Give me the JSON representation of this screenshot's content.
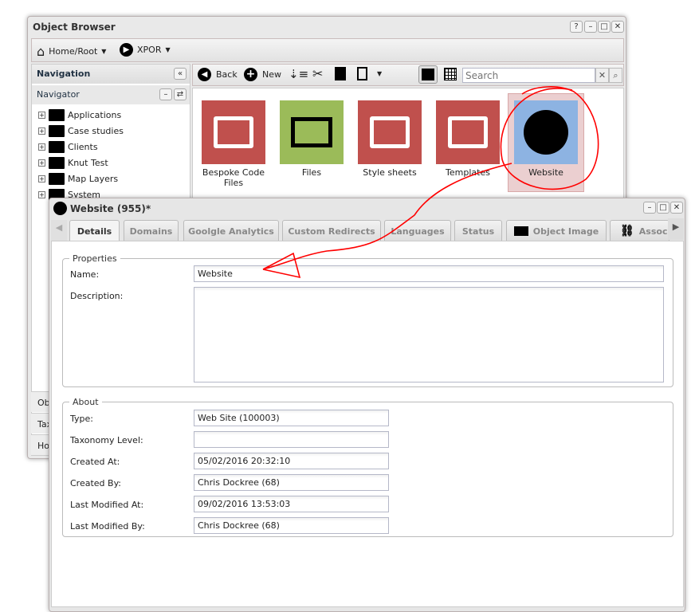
{
  "browser": {
    "title": "Object Browser",
    "title_buttons": [
      "?",
      "–",
      "□",
      "✕"
    ],
    "breadcrumb": [
      {
        "label": "Home/Root",
        "icon": "home-icon"
      },
      {
        "label": "XPOR",
        "icon": "arrow-right-circle-icon"
      }
    ],
    "navigation": {
      "title": "Navigation",
      "navigator_title": "Navigator",
      "tree": [
        "Applications",
        "Case studies",
        "Clients",
        "Knut Test",
        "Map Layers",
        "System"
      ]
    },
    "accordion": [
      "Obj",
      "Tax",
      "Hot"
    ],
    "toolbar": {
      "back": "Back",
      "new": "New",
      "search_placeholder": "Search"
    },
    "tiles": [
      {
        "label": "Bespoke Code Files",
        "color": "#c0504d",
        "icon": "folder-icon"
      },
      {
        "label": "Files",
        "color": "#9bbb59",
        "icon": "images-icon"
      },
      {
        "label": "Style sheets",
        "color": "#c0504d",
        "icon": "folder-icon"
      },
      {
        "label": "Templates",
        "color": "#c0504d",
        "icon": "folder-icon"
      },
      {
        "label": "Website",
        "color": "#8db3e2",
        "icon": "globe-wrench-icon",
        "selected": true
      }
    ]
  },
  "editor": {
    "title": "Website (955)*",
    "tabs": [
      "Details",
      "Domains",
      "Goolgle Analytics",
      "Custom Redirects",
      "Languages",
      "Status",
      "Object Image",
      "Associ"
    ],
    "active_tab": "Details",
    "properties": {
      "legend": "Properties",
      "name_label": "Name:",
      "name_value": "Website",
      "description_label": "Description:",
      "description_value": ""
    },
    "about": {
      "legend": "About",
      "rows": [
        {
          "label": "Type:",
          "value": "Web Site (100003)"
        },
        {
          "label": "Taxonomy Level:",
          "value": ""
        },
        {
          "label": "Created At:",
          "value": "05/02/2016 20:32:10"
        },
        {
          "label": "Created By:",
          "value": "Chris Dockree (68)"
        },
        {
          "label": "Last Modified At:",
          "value": "09/02/2016 13:53:03"
        },
        {
          "label": "Last Modified By:",
          "value": "Chris Dockree (68)"
        }
      ]
    }
  },
  "annotation_color": "#ff0000"
}
